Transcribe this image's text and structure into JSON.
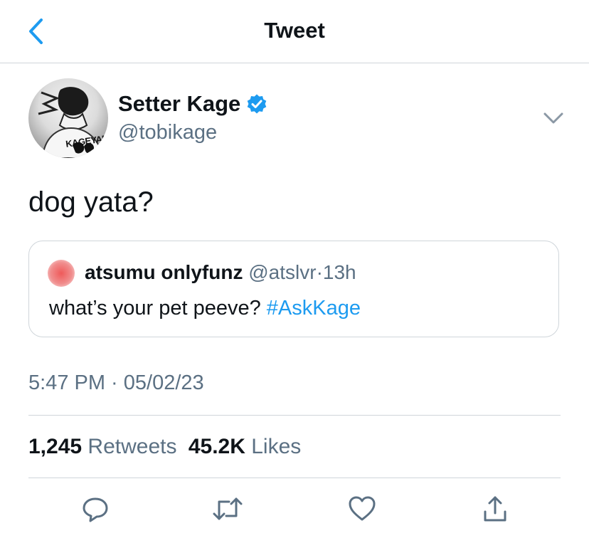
{
  "header": {
    "title": "Tweet",
    "back_icon": "chevron-left-icon"
  },
  "colors": {
    "accent": "#1d9bf0",
    "secondary_text": "#5b7083",
    "divider": "#cfd5da"
  },
  "tweet": {
    "author": {
      "display_name": "Setter Kage",
      "handle": "@tobikage",
      "verified": true,
      "avatar_label": "KAGEYAMA"
    },
    "text": "dog yata?",
    "quoted_tweet": {
      "author_name": "atsumu onlyfunz",
      "author_handle": "@atslvr",
      "separator": "·",
      "time_ago": "13h",
      "text_prefix": "what’s your pet peeve?",
      "hashtag": "#AskKage"
    },
    "timestamp": "5:47 PM · 05/02/23",
    "stats": {
      "retweets_count": "1,245",
      "retweets_label": "Retweets",
      "likes_count": "45.2K",
      "likes_label": "Likes"
    }
  },
  "actions": [
    "reply-icon",
    "retweet-icon",
    "like-icon",
    "share-icon"
  ]
}
